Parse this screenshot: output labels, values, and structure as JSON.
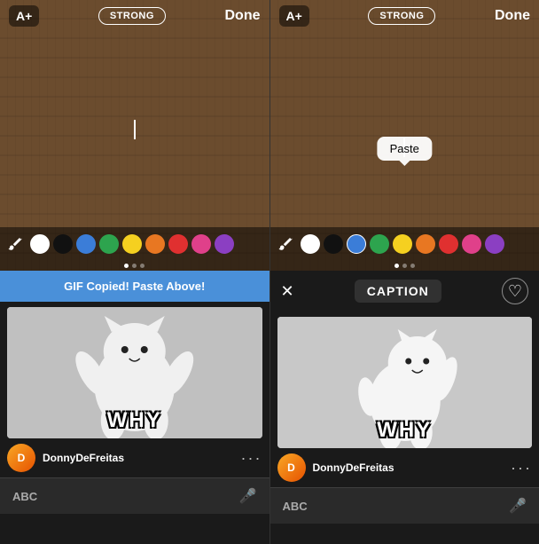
{
  "panels": [
    {
      "id": "left",
      "topbar": {
        "text_size_label": "A+",
        "style_label": "STRONG",
        "done_label": "Done"
      },
      "notification": "GIF Copied! Paste Above!",
      "gif": {
        "why_text": "WHY",
        "username": "DonnyDeFreitas"
      },
      "keyboard": {
        "abc_label": "ABC"
      }
    },
    {
      "id": "right",
      "topbar": {
        "text_size_label": "A+",
        "style_label": "STRONG",
        "done_label": "Done"
      },
      "caption_label": "CAPTION",
      "paste_label": "Paste",
      "gif": {
        "why_text": "WHY",
        "username": "DonnyDeFreitas"
      },
      "keyboard": {
        "abc_label": "ABC"
      }
    }
  ],
  "colors": {
    "white": "#ffffff",
    "black": "#111111",
    "blue": "#3b7dd8",
    "green": "#2da44e",
    "yellow": "#f5d020",
    "orange": "#e87722",
    "red": "#e03030",
    "pink": "#e0408a",
    "purple": "#8b3fc2"
  },
  "palette_indicators": [
    0,
    1,
    2
  ],
  "active_indicator": 0
}
